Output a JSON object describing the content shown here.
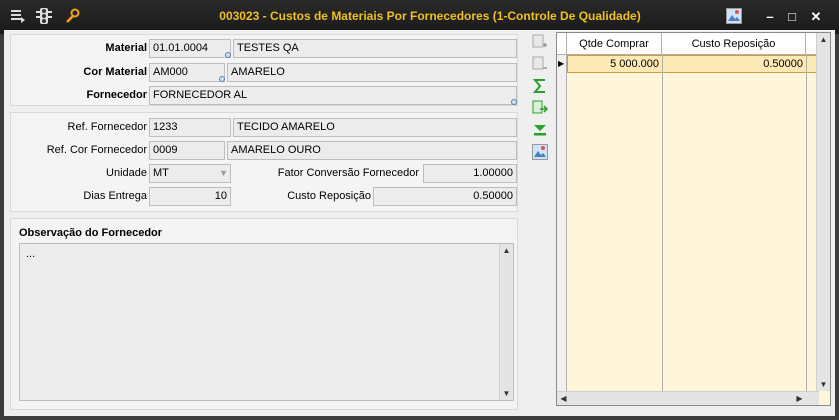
{
  "window": {
    "title": "003023 - Custos de Materiais Por Fornecedores (1-Controle De Qualidade)",
    "buttons": {
      "minimize": "–",
      "maximize": "□",
      "close": "✕"
    }
  },
  "form": {
    "material": {
      "label": "Material",
      "code": "01.01.0004",
      "name": "TESTES QA"
    },
    "cor_material": {
      "label": "Cor Material",
      "code": "AM000",
      "name": "AMARELO"
    },
    "fornecedor": {
      "label": "Fornecedor",
      "value": "FORNECEDOR AL"
    },
    "ref_fornecedor": {
      "label": "Ref. Fornecedor",
      "code": "1233",
      "name": "TECIDO AMARELO"
    },
    "ref_cor_fornecedor": {
      "label": "Ref. Cor Fornecedor",
      "code": "0009",
      "name": "AMARELO OURO"
    },
    "unidade": {
      "label": "Unidade",
      "value": "MT"
    },
    "fator_conversao": {
      "label": "Fator Conversão Fornecedor",
      "value": "1.00000"
    },
    "dias_entrega": {
      "label": "Dias Entrega",
      "value": "10"
    },
    "custo_reposicao": {
      "label": "Custo Reposição",
      "value": "0.50000"
    }
  },
  "observacao": {
    "title": "Observação do Fornecedor",
    "text": "..."
  },
  "grid": {
    "columns": [
      "Qtde Comprar",
      "Custo Reposição"
    ],
    "rows": [
      {
        "qtde": "5 000.000",
        "custo": "0.50000"
      }
    ]
  },
  "colors": {
    "title_text": "#f0c020",
    "grid_bg": "#fff5d8",
    "selected_row": "#fde9b4"
  }
}
